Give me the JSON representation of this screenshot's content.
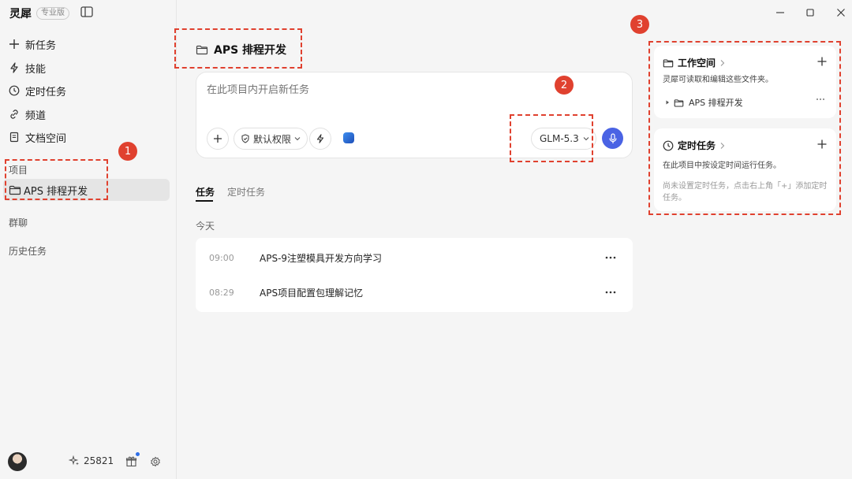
{
  "app": {
    "name": "灵犀",
    "edition": "专业版"
  },
  "sidebar": {
    "nav": [
      {
        "label": "新任务",
        "icon": "plus-icon"
      },
      {
        "label": "技能",
        "icon": "lightning-icon"
      },
      {
        "label": "定时任务",
        "icon": "clock-icon"
      },
      {
        "label": "频道",
        "icon": "link-icon"
      },
      {
        "label": "文档空间",
        "icon": "document-icon"
      }
    ],
    "projects_label": "项目",
    "projects": [
      {
        "label": "APS 排程开发",
        "icon": "folder-icon"
      }
    ],
    "group_chat_label": "群聊",
    "history_label": "历史任务",
    "footer": {
      "credits": "25821"
    }
  },
  "callouts": [
    "1",
    "2",
    "3"
  ],
  "main": {
    "project_title": "APS 排程开发",
    "composer": {
      "placeholder": "在此项目内开启新任务",
      "permission_label": "默认权限",
      "model_label": "GLM-5.3"
    },
    "tabs": [
      {
        "label": "任务",
        "active": true
      },
      {
        "label": "定时任务",
        "active": false
      }
    ],
    "day_label": "今天",
    "tasks": [
      {
        "time": "09:00",
        "title": "APS-9注塑模具开发方向学习"
      },
      {
        "time": "08:29",
        "title": "APS项目配置包理解记忆"
      }
    ]
  },
  "right_panel": {
    "workspace": {
      "title": "工作空间",
      "description": "灵犀可读取和编辑这些文件夹。",
      "folders": [
        {
          "name": "APS 排程开发"
        }
      ]
    },
    "scheduled": {
      "title": "定时任务",
      "description": "在此项目中按设定时间运行任务。",
      "empty_note": "尚未设置定时任务，点击右上角「+」添加定时任务。"
    }
  },
  "colors": {
    "accent": "#4a63e4",
    "annotation": "#e0412f",
    "badge_dot": "#2f6fe8"
  }
}
